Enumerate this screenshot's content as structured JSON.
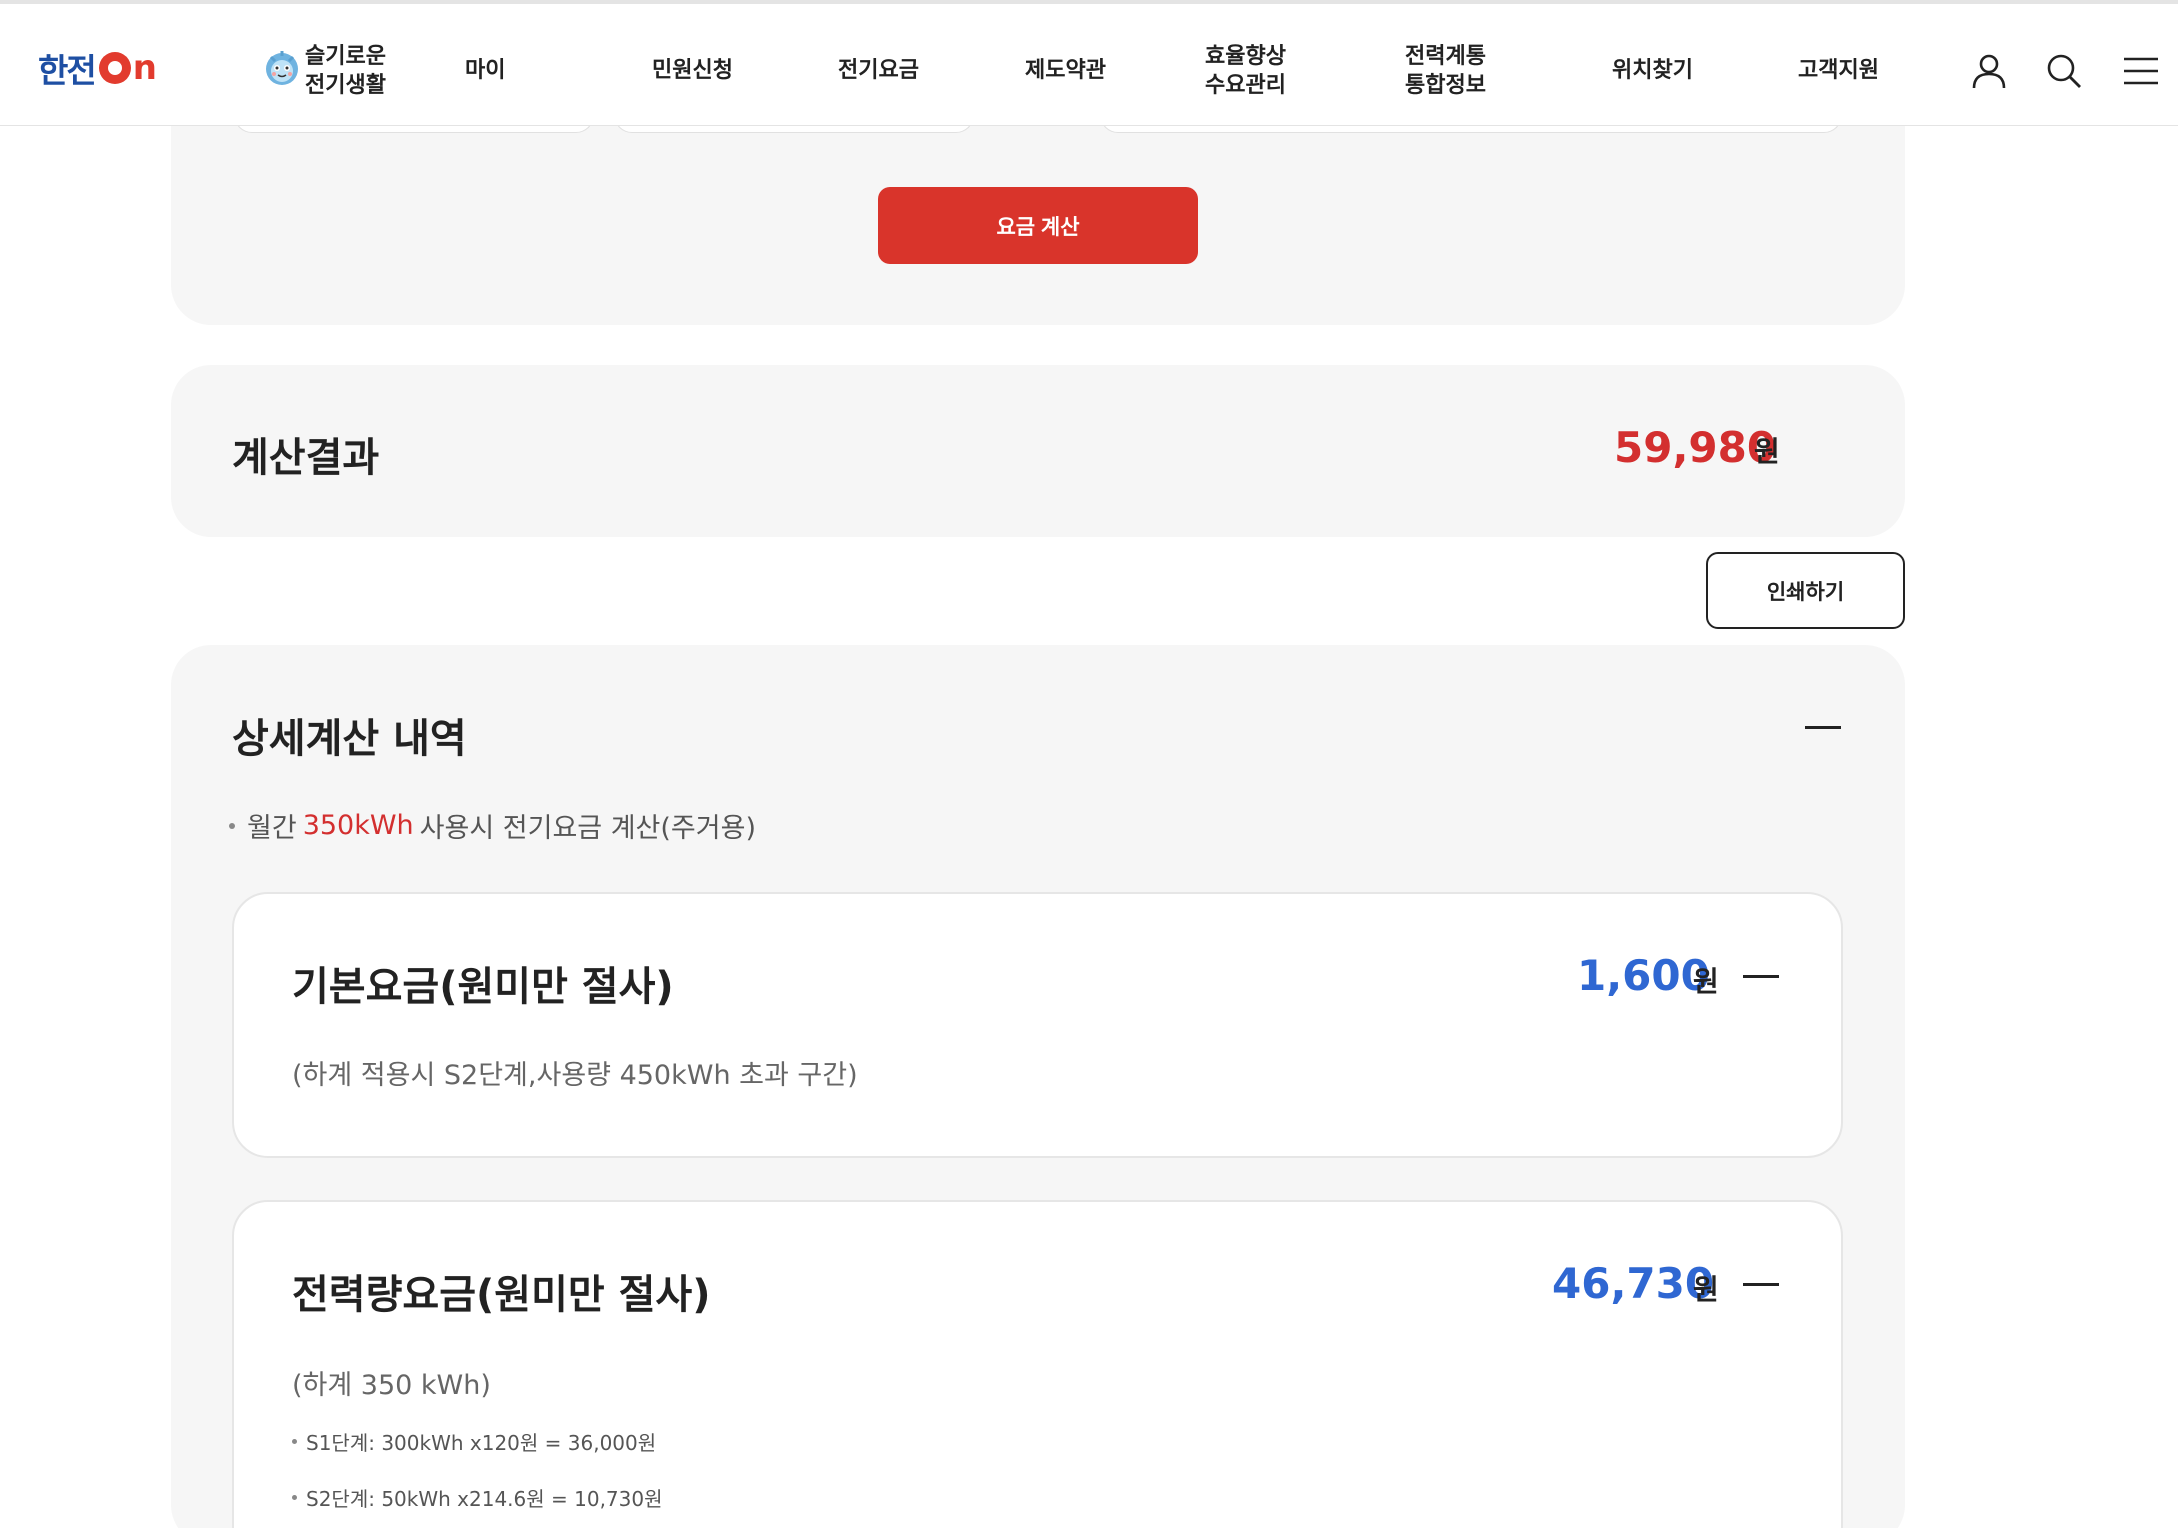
{
  "header": {
    "logo_text": "한전",
    "logo_suffix": "n",
    "smart_life_line1": "슬기로운",
    "smart_life_line2": "전기생활",
    "nav": {
      "my": "마이",
      "civil": "민원신청",
      "rates": "전기요금",
      "policy": "제도약관",
      "efficiency_line1": "효율향상",
      "efficiency_line2": "수요관리",
      "grid_line1": "전력계통",
      "grid_line2": "통합정보",
      "location": "위치찾기",
      "support": "고객지원"
    },
    "icons": [
      "user-icon",
      "search-icon",
      "menu-icon"
    ]
  },
  "calc": {
    "button_label": "요금 계산"
  },
  "result": {
    "title": "계산결과",
    "amount": "59,980",
    "unit": "원",
    "print_label": "인쇄하기"
  },
  "detail": {
    "title": "상세계산 내역",
    "note_prefix": "월간",
    "note_highlight": "350kWh",
    "note_suffix": "사용시 전기요금 계산(주거용)",
    "items": [
      {
        "title": "기본요금(원미만 절사)",
        "amount": "1,600",
        "unit": "원",
        "sub": "(하계 적용시 S2단계,사용량 450kWh 초과 구간)"
      },
      {
        "title": "전력량요금(원미만 절사)",
        "amount": "46,730",
        "unit": "원",
        "sub": "(하계 350 kWh)",
        "lines": [
          "S1단계: 300kWh x120원 = 36,000원",
          "S2단계: 50kWh x214.6원 = 10,730원"
        ]
      }
    ]
  },
  "colors": {
    "brand_blue": "#1e4fa3",
    "brand_red": "#e23b2e",
    "button_red": "#d9342b",
    "amount_red": "#d32f2f",
    "amount_blue": "#2f67d2",
    "panel_bg": "#f6f6f6"
  }
}
